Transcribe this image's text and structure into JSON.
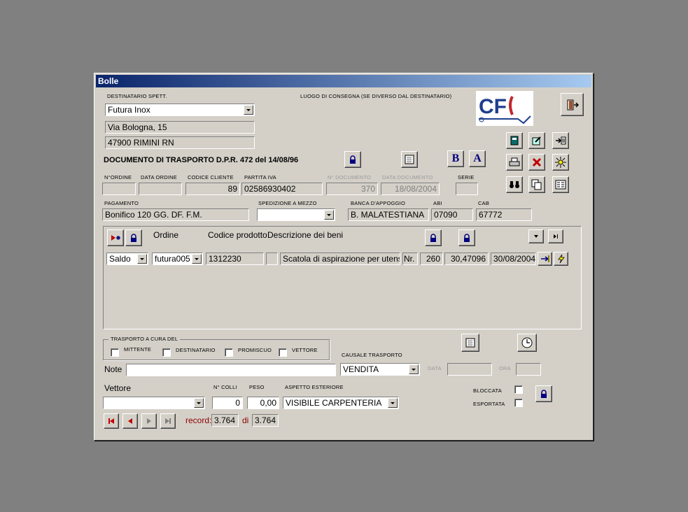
{
  "window": {
    "title": "Bolle"
  },
  "logo": {
    "text": "CF",
    "brand_color": "#1f3f8c",
    "accent": "#c0282d"
  },
  "destinatario": {
    "label": "DESTINATARIO SPETT.",
    "name": "Futura Inox",
    "address": "Via Bologna, 15",
    "city": "47900 RIMINI RN"
  },
  "luogo_label": "LUOGO DI CONSEGNA (SE DIVERSO DAL DESTINATARIO)",
  "doc_title": "DOCUMENTO DI TRASPORTO D.P.R. 472 del 14/08/96",
  "font_buttons": {
    "bold": "B",
    "a": "A"
  },
  "header_fields": {
    "ordine_label": "N°ORDINE",
    "data_ordine_label": "DATA ORDINE",
    "codice_cliente_label": "CODICE CLIENTE",
    "codice_cliente": "89",
    "partita_iva_label": "PARTITA IVA",
    "partita_iva": "02586930402",
    "n_documento_label": "N° DOCUMENTO",
    "n_documento": "370",
    "data_documento_label": "DATA DOCUMENTO",
    "data_documento": "18/08/2004",
    "serie_label": "SERIE"
  },
  "payment": {
    "pagamento_label": "PAGAMENTO",
    "pagamento": "Bonifico 120 GG. DF. F.M.",
    "spedizione_label": "SPEDIZIONE A MEZZO",
    "banca_label": "BANCA D'APPOGGIO",
    "banca": "B. MALATESTIANA",
    "abi_label": "ABI",
    "abi": "07090",
    "cab_label": "CAB",
    "cab": "67772"
  },
  "lines": {
    "col_ordine": "Ordine",
    "col_codice": "Codice prodotto",
    "col_descr": "Descrizione dei beni",
    "row": {
      "tipo": "Saldo",
      "ordine": "futura005",
      "codice": "1312230",
      "descrizione": "Scatola di aspirazione per utensile c",
      "um": "Nr.",
      "qta": "260",
      "prezzo": "30,47096",
      "data": "30/08/2004"
    }
  },
  "trasporto": {
    "group_label": "TRASPORTO A CURA DEL",
    "mittente": "MITTENTE",
    "destinatario": "DESTINATARIO",
    "promiscuo": "PROMISCUO",
    "vettore": "VETTORE"
  },
  "note_label": "Note",
  "causale_label": "CAUSALE TRASPORTO",
  "causale": "VENDITA",
  "data_label": "DATA",
  "ora_label": "ORA",
  "vettore_label": "Vettore",
  "colli_label": "N° COLLI",
  "colli": "0",
  "peso_label": "PESO",
  "peso": "0,00",
  "aspetto_label": "ASPETTO ESTERIORE",
  "aspetto": "VISIBILE CARPENTERIA",
  "bloccata_label": "BLOCCATA",
  "esportata_label": "ESPORTATA",
  "record": {
    "label": "record:",
    "current": "3.764",
    "of": "di",
    "total": "3.764"
  }
}
